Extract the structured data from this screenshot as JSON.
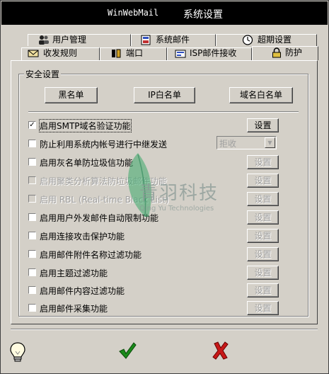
{
  "window": {
    "title_app": "WinWebMail",
    "title_text": "系统设置"
  },
  "tabs_top": [
    {
      "label": "用户管理",
      "icon": "users-icon"
    },
    {
      "label": "系统邮件",
      "icon": "system-mail-icon"
    },
    {
      "label": "超期设置",
      "icon": "clock-icon"
    }
  ],
  "tabs_bottom": [
    {
      "label": "收发规则",
      "icon": "rules-icon"
    },
    {
      "label": "端口",
      "icon": "port-icon"
    },
    {
      "label": "ISP邮件接收",
      "icon": "isp-mail-icon"
    },
    {
      "label": "防护",
      "icon": "lock-icon",
      "active": true
    }
  ],
  "security": {
    "group_label": "安全设置",
    "buttons": {
      "blacklist": "黑名单",
      "ip_whitelist": "IP白名单",
      "domain_whitelist": "域名白名单"
    },
    "options": [
      {
        "label": "启用SMTP域名验证功能",
        "checked": true,
        "enabled": true,
        "button": "设置",
        "button_enabled": true
      },
      {
        "label": "防止利用系统内帐号进行中继发送",
        "checked": false,
        "enabled": true,
        "select": "拒收"
      },
      {
        "label": "启用灰名单防垃圾信功能",
        "checked": false,
        "enabled": true,
        "button": "设置",
        "button_enabled": false
      },
      {
        "label": "启用聚类分析算法防垃圾邮件功能",
        "checked": false,
        "enabled": false,
        "button": "设置",
        "button_enabled": false
      },
      {
        "label": "启用 RBL (Real-time Black List)",
        "checked": false,
        "enabled": false,
        "button": "设置",
        "button_enabled": false
      },
      {
        "label": "启用用户外发邮件自动限制功能",
        "checked": false,
        "enabled": true,
        "button": "设置",
        "button_enabled": false
      },
      {
        "label": "启用连接攻击保护功能",
        "checked": false,
        "enabled": true,
        "button": "设置",
        "button_enabled": false
      },
      {
        "label": "启用邮件附件名称过滤功能",
        "checked": false,
        "enabled": true,
        "button": "设置",
        "button_enabled": false
      },
      {
        "label": "启用主题过滤功能",
        "checked": false,
        "enabled": true,
        "button": "设置",
        "button_enabled": false
      },
      {
        "label": "启用邮件内容过滤功能",
        "checked": false,
        "enabled": true,
        "button": "设置",
        "button_enabled": false
      },
      {
        "label": "启用邮件采集功能",
        "checked": false,
        "enabled": true,
        "button": "设置",
        "button_enabled": false
      }
    ]
  },
  "watermark": {
    "text": "青羽科技",
    "sub": "Qing Yu Technologies"
  },
  "footer": {
    "help_icon": "lightbulb-icon",
    "ok_icon": "check-icon",
    "cancel_icon": "x-icon",
    "ok_color": "#1a8a1a",
    "cancel_color": "#c81818"
  }
}
